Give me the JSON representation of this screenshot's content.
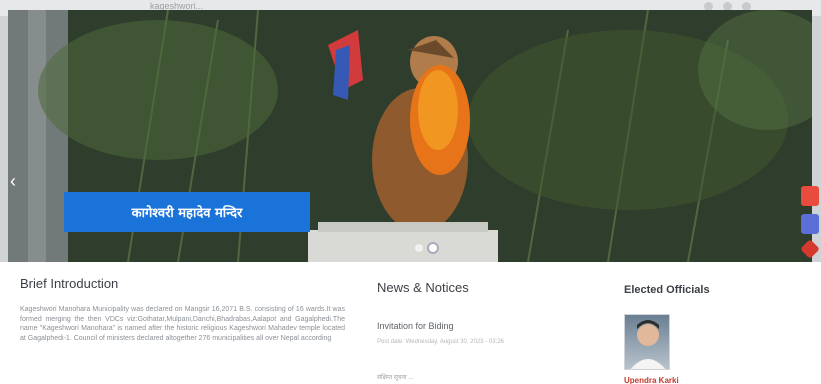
{
  "browser": {
    "url_fragment": "kageshwori..."
  },
  "slider": {
    "caption": "कागेश्वरी महादेव मन्दिर",
    "dots": 2,
    "active_dot": 1
  },
  "intro": {
    "heading": "Brief Introduction",
    "text": "Kageshwori Manohara Municipality was declared on Mangsir 16,2071 B.S. consisting of 16 wards.It was formed merging the then VDCs viz:Gothatar,Mulpani,Danchi,Bhadrabas,Aalapot and Gagalphedi.The name \"Kageshwori Manohara\" is named after the historic religious Kageshwori Mahadev temple located at Gagalphedi-1. Council of ministers declared altogether 276 municipalities all over Nepal according"
  },
  "news": {
    "heading": "News & Notices",
    "items": [
      {
        "title": "Invitation for Biding",
        "date": "Post date: Wednesday, August 30, 2023 - 03:26"
      },
      {
        "title": "संक्षिप्त सूचना ...",
        "date": ""
      }
    ]
  },
  "officials": {
    "heading": "Elected Officials",
    "name": "Upendra Karki"
  },
  "colors": {
    "caption_bg": "#1a73d9",
    "official_name": "#c0392b",
    "side_icon_1": "#e74c3c",
    "side_icon_2": "#5b6fd6",
    "side_icon_3": "#d63a2f"
  }
}
